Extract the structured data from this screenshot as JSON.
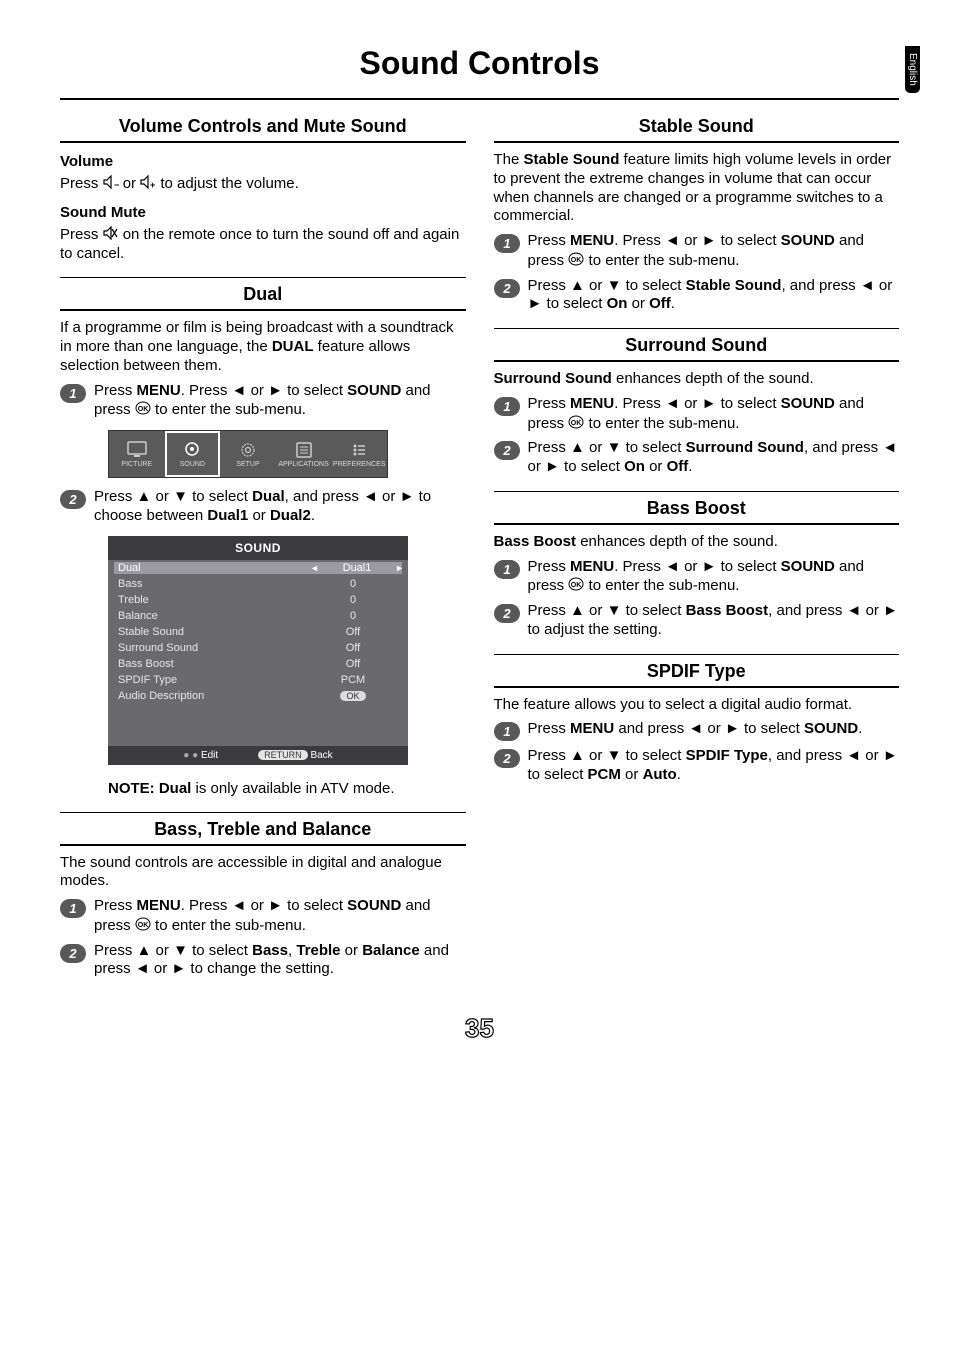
{
  "lang_tab": "English",
  "page_title": "Sound Controls",
  "page_number": "35",
  "glyphs": {
    "left": "◄",
    "right": "►",
    "up": "▲",
    "down": "▼",
    "ok": "㉫",
    "mute": "🔇",
    "vol_down": "🔈₋",
    "vol_up": "🔈₊",
    "dot": "●"
  },
  "left": {
    "vol_mute": {
      "title": "Volume Controls and Mute Sound",
      "volume_head": "Volume",
      "volume_body_pre": "Press ",
      "volume_body_mid": " or ",
      "volume_body_post": " to adjust the volume.",
      "mute_head": "Sound Mute",
      "mute_body_pre": "Press ",
      "mute_body_post": " on the remote once to turn the sound off and again to cancel."
    },
    "dual": {
      "title": "Dual",
      "intro": "If a programme or film is being broadcast with a soundtrack in more than one language, the DUAL feature allows selection between them.",
      "intro_bold": "DUAL",
      "step1_pre": "Press ",
      "step1_menu": "MENU",
      "step1_mid1": ". Press ",
      "step1_mid2": " or ",
      "step1_mid3": " to select ",
      "step1_sound": "SOUND",
      "step1_mid4": " and press ",
      "step1_end": " to enter the sub-menu.",
      "icon_labels": [
        "PICTURE",
        "SOUND",
        "SETUP",
        "APPLICATIONS",
        "PREFERENCES"
      ],
      "step2_pre": "Press ",
      "step2_mid1": " or ",
      "step2_mid2": " to select ",
      "step2_dual": "Dual",
      "step2_mid3": ", and press ",
      "step2_mid4": " or ",
      "step2_mid5": " to choose between ",
      "step2_d1": "Dual1",
      "step2_mid6": " or ",
      "step2_d2": "Dual2",
      "step2_end": ".",
      "panel_title": "SOUND",
      "panel_rows": [
        {
          "k": "Dual",
          "v": "Dual1",
          "sel": true,
          "arrows": true
        },
        {
          "k": "Bass",
          "v": "0"
        },
        {
          "k": "Treble",
          "v": "0"
        },
        {
          "k": "Balance",
          "v": "0"
        },
        {
          "k": "Stable Sound",
          "v": "Off"
        },
        {
          "k": "Surround Sound",
          "v": "Off"
        },
        {
          "k": "Bass Boost",
          "v": "Off"
        },
        {
          "k": "SPDIF Type",
          "v": "PCM"
        },
        {
          "k": "Audio Description",
          "v": "OK",
          "ok": true
        }
      ],
      "foot_edit_prefix": "● ● ",
      "foot_edit": "Edit",
      "foot_return_pill": "RETURN",
      "foot_back": "Back",
      "note_label": "NOTE:",
      "note_bold": "Dual",
      "note_rest": " is only available in ATV mode."
    },
    "btb": {
      "title": "Bass, Treble and Balance",
      "intro": "The sound controls are accessible in digital and analogue modes.",
      "step1_pre": "Press ",
      "step1_menu": "MENU",
      "step1_mid1": ". Press ",
      "step1_mid2": " or ",
      "step1_mid3": " to select ",
      "step1_sound": "SOUND",
      "step1_mid4": " and press ",
      "step1_end": " to enter the sub-menu.",
      "step2_pre": "Press ",
      "step2_mid1": " or ",
      "step2_mid2": " to select ",
      "step2_b": "Bass",
      "step2_c1": ", ",
      "step2_t": "Treble",
      "step2_c2": " or ",
      "step2_bal": "Balance",
      "step2_mid3": " and press ",
      "step2_mid4": " or ",
      "step2_end": " to change the setting."
    }
  },
  "right": {
    "stable": {
      "title": "Stable Sound",
      "intro_pre": "The ",
      "intro_bold": "Stable Sound",
      "intro_post": " feature limits high volume levels in order to prevent the extreme changes in volume that can occur when channels are changed or a programme switches to a commercial.",
      "s1_pre": "Press ",
      "s1_menu": "MENU",
      "s1_mid1": ". Press ",
      "s1_mid2": " or ",
      "s1_mid3": " to select ",
      "s1_sound": "SOUND",
      "s1_mid4": " and press ",
      "s1_end": " to enter the sub-menu.",
      "s2_pre": "Press ",
      "s2_mid1": " or ",
      "s2_mid2": " to select ",
      "s2_bold": "Stable Sound",
      "s2_mid3": ", and press ",
      "s2_mid4": " or ",
      "s2_mid5": " to select ",
      "s2_on": "On",
      "s2_mid6": " or ",
      "s2_off": "Off",
      "s2_end": "."
    },
    "surround": {
      "title": "Surround Sound",
      "intro_bold": "Surround Sound",
      "intro_post": " enhances depth of the sound.",
      "s1_pre": "Press ",
      "s1_menu": "MENU",
      "s1_mid1": ". Press ",
      "s1_mid2": " or ",
      "s1_mid3": " to select ",
      "s1_sound": "SOUND",
      "s1_mid4": " and press ",
      "s1_end": " to enter the sub-menu.",
      "s2_pre": "Press ",
      "s2_mid1": " or ",
      "s2_mid2": " to select ",
      "s2_bold": "Surround Sound",
      "s2_mid3": ", and press ",
      "s2_mid4": " or ",
      "s2_mid5": " to select ",
      "s2_on": "On",
      "s2_mid6": " or ",
      "s2_off": "Off",
      "s2_end": "."
    },
    "bassboost": {
      "title": "Bass Boost",
      "intro_bold": "Bass Boost",
      "intro_post": " enhances depth of the sound.",
      "s1_pre": "Press ",
      "s1_menu": "MENU",
      "s1_mid1": ". Press ",
      "s1_mid2": " or ",
      "s1_mid3": " to select ",
      "s1_sound": "SOUND",
      "s1_mid4": " and press ",
      "s1_end": " to enter the sub-menu.",
      "s2_pre": "Press ",
      "s2_mid1": " or ",
      "s2_mid2": " to select ",
      "s2_bold": "Bass Boost",
      "s2_mid3": ", and press ",
      "s2_mid4": " or ",
      "s2_end": " to adjust the setting."
    },
    "spdif": {
      "title": "SPDIF Type",
      "intro": "The feature allows you to select a digital audio format.",
      "s1_pre": "Press ",
      "s1_menu": "MENU",
      "s1_mid1": " and press ",
      "s1_mid2": " or ",
      "s1_mid3": " to select ",
      "s1_sound": "SOUND",
      "s1_end": ".",
      "s2_pre": "Press ",
      "s2_mid1": " or ",
      "s2_mid2": " to select ",
      "s2_bold": "SPDIF Type",
      "s2_mid3": ", and press ",
      "s2_mid4": " or ",
      "s2_mid5": " to select ",
      "s2_pcm": "PCM",
      "s2_mid6": " or ",
      "s2_auto": "Auto",
      "s2_end": "."
    }
  }
}
